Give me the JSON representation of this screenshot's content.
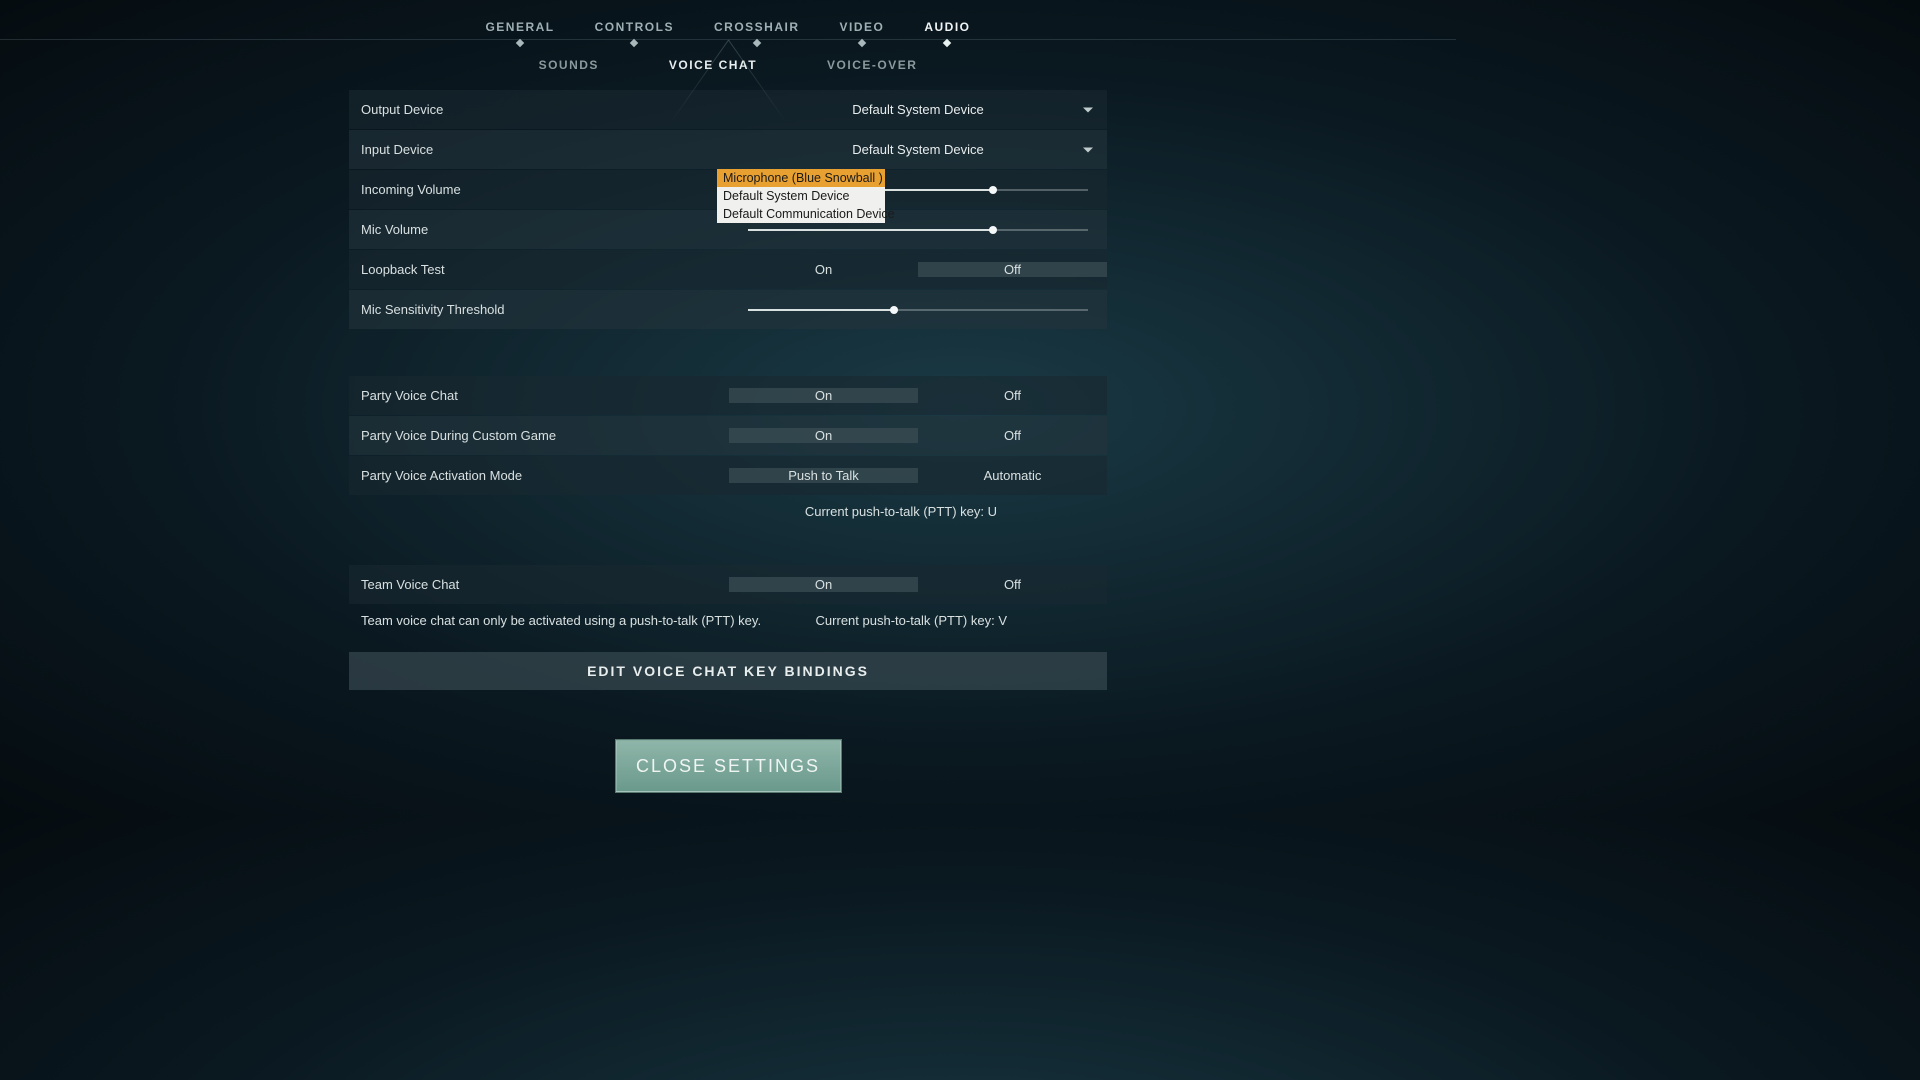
{
  "tabs": {
    "main": [
      "GENERAL",
      "CONTROLS",
      "CROSSHAIR",
      "VIDEO",
      "AUDIO"
    ],
    "main_active": 4,
    "sub": [
      "SOUNDS",
      "VOICE CHAT",
      "VOICE-OVER"
    ],
    "sub_active": 1
  },
  "settings": {
    "output_device": {
      "label": "Output Device",
      "value": "Default System Device"
    },
    "input_device": {
      "label": "Input Device",
      "value": "Default System Device",
      "options": [
        "Microphone (Blue Snowball )",
        "Default System Device",
        "Default Communication Device"
      ],
      "highlighted": 0
    },
    "incoming_volume": {
      "label": "Incoming Volume",
      "value": 72
    },
    "mic_volume": {
      "label": "Mic Volume",
      "value": 72
    },
    "loopback": {
      "label": "Loopback Test",
      "options": [
        "On",
        "Off"
      ],
      "selected": 1
    },
    "mic_sens": {
      "label": "Mic Sensitivity Threshold",
      "value": 43
    },
    "party_voice": {
      "label": "Party Voice Chat",
      "options": [
        "On",
        "Off"
      ],
      "selected": 0
    },
    "party_custom": {
      "label": "Party Voice During Custom Game",
      "options": [
        "On",
        "Off"
      ],
      "selected": 0
    },
    "party_activation": {
      "label": "Party Voice Activation Mode",
      "options": [
        "Push to Talk",
        "Automatic"
      ],
      "selected": 0
    },
    "party_ptt_hint": "Current push-to-talk (PTT) key: U",
    "team_voice": {
      "label": "Team Voice Chat",
      "options": [
        "On",
        "Off"
      ],
      "selected": 0
    },
    "team_hint_left": "Team voice chat can only be activated using a push-to-talk (PTT) key.",
    "team_hint_right": "Current push-to-talk (PTT) key: V",
    "edit_bindings": "EDIT VOICE CHAT KEY BINDINGS"
  },
  "close": "CLOSE SETTINGS"
}
